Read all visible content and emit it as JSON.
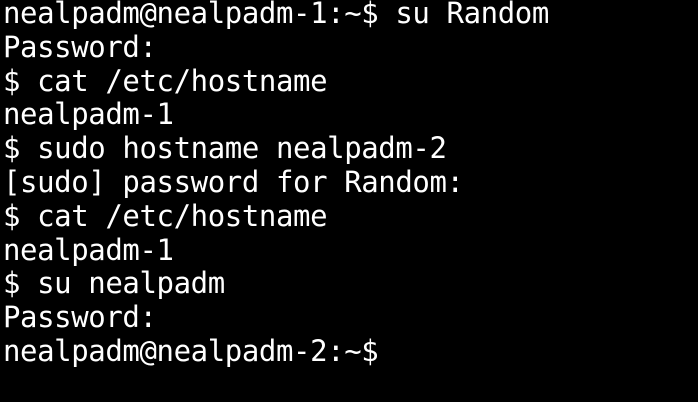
{
  "terminal": {
    "lines": [
      "nealpadm@nealpadm-1:~$ su Random",
      "Password:",
      "$ cat /etc/hostname",
      "nealpadm-1",
      "$ sudo hostname nealpadm-2",
      "[sudo] password for Random:",
      "$ cat /etc/hostname",
      "nealpadm-1",
      "$ su nealpadm",
      "Password:",
      "nealpadm@nealpadm-2:~$"
    ],
    "colors": {
      "background": "#000000",
      "foreground": "#ffffff"
    }
  }
}
